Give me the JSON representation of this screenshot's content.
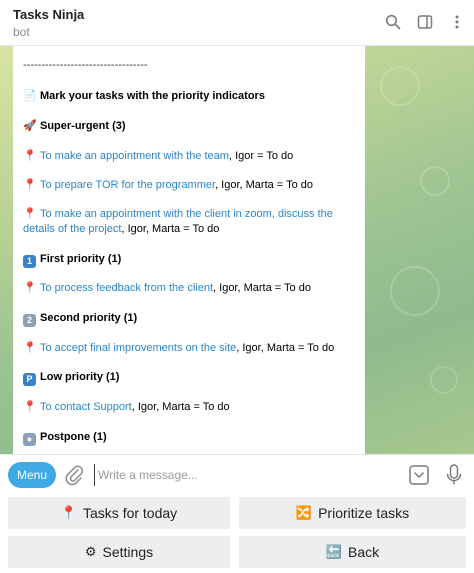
{
  "header": {
    "title": "Tasks Ninja",
    "subtitle": "bot"
  },
  "message": {
    "separator": "----------------------------------",
    "heading": "Mark your tasks with the priority indicators",
    "sections": {
      "super_urgent": "Super-urgent (3)",
      "first": "First priority (1)",
      "second": "Second priority (1)",
      "low": "Low priority (1)",
      "postpone": "Postpone (1)"
    },
    "tasks": [
      {
        "link": "To make an appointment with the team",
        "rest": ", Igor = To do"
      },
      {
        "link": "To prepare TOR for the programmer",
        "rest": ", Igor, Marta = To do"
      },
      {
        "link": "To make an appointment with the client in zoom, discuss the details of the project",
        "rest": ", Igor, Marta = To do"
      },
      {
        "link": "To process feedback from the client",
        "rest": ", Igor, Marta = To do"
      },
      {
        "link": "To accept final improvements on the site",
        "rest": ", Igor, Marta = To do"
      },
      {
        "link": "To contact Support",
        "rest": ", Igor, Marta = To do"
      }
    ],
    "badges": {
      "first": "1",
      "second": "2",
      "low": "P"
    }
  },
  "composer": {
    "menu_label": "Menu",
    "placeholder": "Write a message..."
  },
  "keyboard": {
    "tasks_today": "Tasks for today",
    "prioritize": "Prioritize tasks",
    "settings": "Settings",
    "back": "Back"
  },
  "colors": {
    "link": "#2a86c8",
    "accent": "#3fa9e6",
    "key_bg": "#eceeef"
  }
}
